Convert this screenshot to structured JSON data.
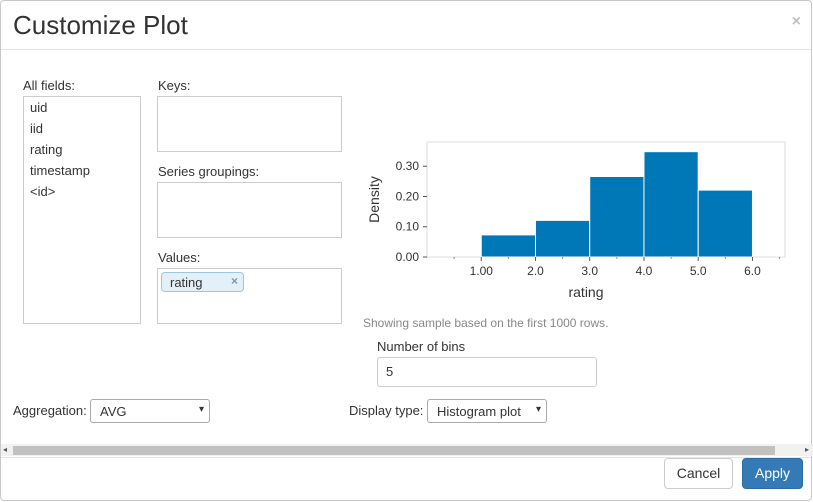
{
  "dialog": {
    "title": "Customize Plot",
    "close_label": "×"
  },
  "fields": {
    "all_label": "All fields:",
    "items": [
      "uid",
      "iid",
      "rating",
      "timestamp",
      "<id>"
    ],
    "keys_label": "Keys:",
    "series_label": "Series groupings:",
    "values_label": "Values:",
    "value_chip": "rating",
    "chip_remove": "×"
  },
  "chart_data": {
    "type": "bar",
    "subtype": "histogram",
    "xlabel": "rating",
    "ylabel": "Density",
    "bin_edges": [
      1.0,
      2.0,
      3.0,
      4.0,
      5.0,
      6.0
    ],
    "values": [
      0.073,
      0.121,
      0.266,
      0.348,
      0.221
    ],
    "xlim": [
      0,
      6.6
    ],
    "ylim": [
      0,
      0.38
    ],
    "xticks": [
      "1.00",
      "2.0",
      "3.0",
      "4.0",
      "5.0",
      "6.0"
    ],
    "yticks": [
      "0.00",
      "0.10",
      "0.20",
      "0.30"
    ],
    "bar_color": "#0077b6"
  },
  "sample_note": "Showing sample based on the first 1000 rows.",
  "bins": {
    "label": "Number of bins",
    "value": "5"
  },
  "aggregation": {
    "label": "Aggregation:",
    "value": "AVG"
  },
  "display_type": {
    "label": "Display type:",
    "value": "Histogram plot"
  },
  "icons": {
    "chevron": "chevron-down-icon",
    "scroll_left": "◂",
    "scroll_right": "▸"
  },
  "footer": {
    "cancel": "Cancel",
    "apply": "Apply"
  },
  "colors": {
    "primary": "#337ab7",
    "bar": "#0077b6"
  }
}
